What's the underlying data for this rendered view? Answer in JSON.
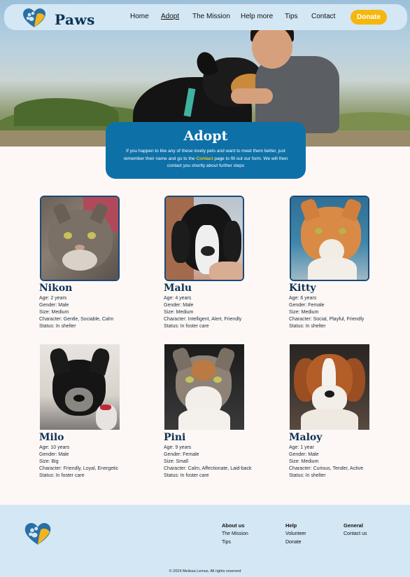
{
  "brand": {
    "name": "Paws",
    "logo_icon": "paw-heart-icon"
  },
  "nav": {
    "items": [
      {
        "label": "Home"
      },
      {
        "label": "Adopt"
      },
      {
        "label": "The Mission"
      },
      {
        "label": "Help more"
      },
      {
        "label": "Tips"
      },
      {
        "label": "Contact"
      }
    ],
    "active": "Adopt",
    "donate_label": "Donate"
  },
  "colors": {
    "accent": "#f5b70c",
    "primary": "#0d71a8",
    "nav_bg": "#d4e7f4",
    "heading": "#0e3255"
  },
  "intro": {
    "title": "Adopt",
    "text_before": "If you happen to like any of these lovely pets and want to meet them better, just remember their name and go to the ",
    "link": "Contact",
    "text_after": " page to fill out our form. We will then contact you shortly about further steps"
  },
  "pets": [
    {
      "name": "Nikon",
      "age": "Age: 2 years",
      "gender": "Gender: Male",
      "size": "Size: Medium",
      "character": "Character: Gentle, Sociable, Calm",
      "status": "Status: In shelter"
    },
    {
      "name": "Malu",
      "age": "Age: 4 years",
      "gender": "Gender: Male",
      "size": "Size: Medium",
      "character": "Character: Intelligent, Alert, Friendly",
      "status": "Status: In foster care"
    },
    {
      "name": "Kitty",
      "age": "Age: 6 years",
      "gender": "Gender: Female",
      "size": "Size: Medium",
      "character": "Character: Social, Playful, Friendly",
      "status": "Status: In shelter"
    },
    {
      "name": "Milo",
      "age": "Age: 10 years",
      "gender": "Gender: Male",
      "size": "Size: Big",
      "character": "Character: Friendly, Loyal, Energetic",
      "status": "Status: In foster care"
    },
    {
      "name": "Pini",
      "age": "Age: 9 years",
      "gender": "Gender: Female",
      "size": "Size: Small",
      "character": "Character: Calm, Affectionate, Laid-back",
      "status": "Status: In foster care"
    },
    {
      "name": "Maloy",
      "age": "Age: 1 year",
      "gender": "Gender: Male",
      "size": "Size: Medium",
      "character": "Character: Curious, Tender, Active",
      "status": "Status: In shelter"
    }
  ],
  "footer": {
    "columns": [
      {
        "heading": "About us",
        "links": [
          "The Mission",
          "Tips"
        ]
      },
      {
        "heading": "Help",
        "links": [
          "Volunteer",
          "Donate"
        ]
      },
      {
        "heading": "General",
        "links": [
          "Contact us"
        ]
      }
    ],
    "copyright": "© 2024 Melissa  Lemus. All rights reserved"
  }
}
